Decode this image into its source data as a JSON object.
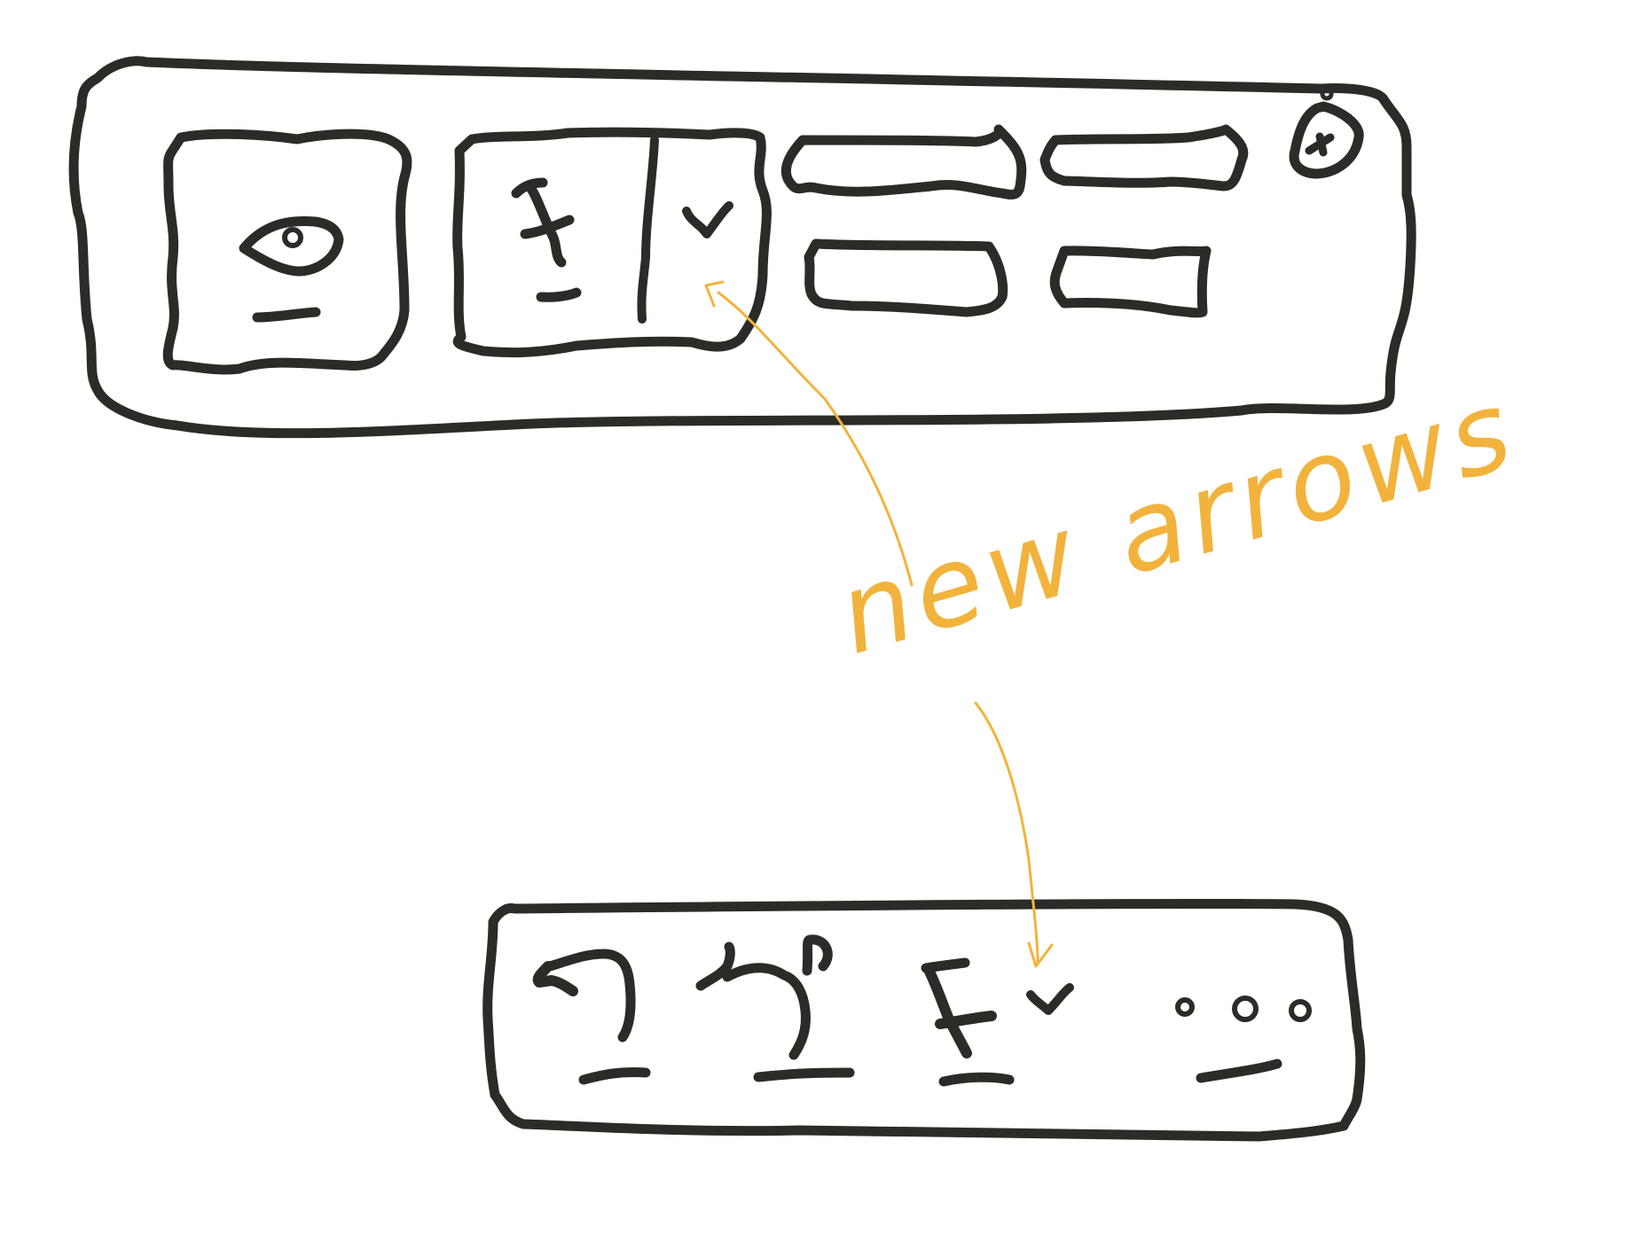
{
  "colors": {
    "ink": "#2b2b27",
    "annotation": "#f2b33d",
    "background": "#ffffff"
  },
  "top_toolbar": {
    "icons": [
      "eye-icon",
      "bookmark-icon",
      "checkmark-dropdown-icon",
      "user-avatar-icon"
    ]
  },
  "bottom_toolbar": {
    "icons": [
      "undo-icon",
      "redo-icon",
      "bookmark-icon",
      "checkmark-dropdown-icon",
      "more-options-icon"
    ]
  },
  "annotation": {
    "text": "new arrows"
  }
}
